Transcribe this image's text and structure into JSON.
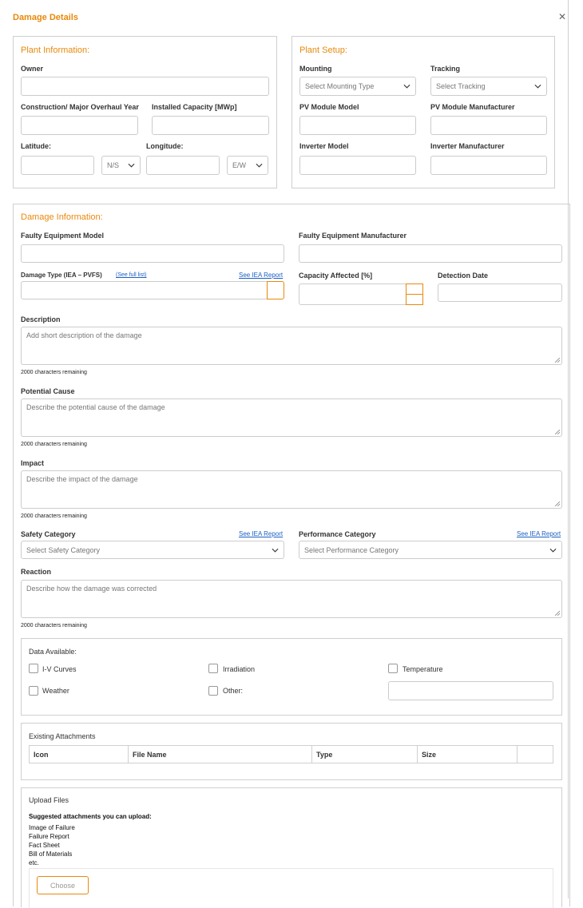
{
  "dialog": {
    "title": "Damage Details"
  },
  "plant_info": {
    "title": "Plant Information:",
    "owner_label": "Owner",
    "construction_label": "Construction/ Major Overhaul Year",
    "capacity_label": "Installed Capacity [MWp]",
    "latitude_label": "Latitude:",
    "longitude_label": "Longitude:",
    "ns_value": "N/S",
    "ew_value": "E/W"
  },
  "plant_setup": {
    "title": "Plant Setup:",
    "mounting_label": "Mounting",
    "mounting_placeholder": "Select Mounting Type",
    "tracking_label": "Tracking",
    "tracking_placeholder": "Select Tracking",
    "pv_model_label": "PV Module Model",
    "pv_manufacturer_label": "PV Module Manufacturer",
    "inverter_model_label": "Inverter Model",
    "inverter_manufacturer_label": "Inverter Manufacturer"
  },
  "damage_info": {
    "title": "Damage Information:",
    "faulty_model_label": "Faulty Equipment Model",
    "faulty_manufacturer_label": "Faulty Equipment Manufacturer",
    "damage_type_label": "Damage Type (IEA – PVFS)",
    "see_full_list": "(See full list)",
    "see_iea_report": "See IEA Report",
    "capacity_affected_label": "Capacity Affected [%]",
    "detection_date_label": "Detection Date",
    "description_label": "Description",
    "description_placeholder": "Add short description of the damage",
    "chars_remaining": "2000 characters remaining",
    "cause_label": "Potential Cause",
    "cause_placeholder": "Describe the potential cause of the damage",
    "impact_label": "Impact",
    "impact_placeholder": "Describe the impact of the damage",
    "safety_label": "Safety Category",
    "safety_placeholder": "Select Safety Category",
    "performance_label": "Performance Category",
    "performance_placeholder": "Select Performance Category",
    "reaction_label": "Reaction",
    "reaction_placeholder": "Describe how the damage was corrected"
  },
  "data_available": {
    "title": "Data Available:",
    "options": [
      "I-V Curves",
      "Irradiation",
      "Temperature",
      "Weather",
      "Other:"
    ]
  },
  "attachments": {
    "title": "Existing Attachments",
    "columns": [
      "Icon",
      "File Name",
      "Type",
      "Size"
    ]
  },
  "upload": {
    "title": "Upload Files",
    "suggested_title": "Suggested attachments you can upload:",
    "suggested": [
      "Image of Failure",
      "Failure Report",
      "Fact Sheet",
      "Bill of Materials",
      "etc."
    ],
    "choose_label": "Choose"
  }
}
